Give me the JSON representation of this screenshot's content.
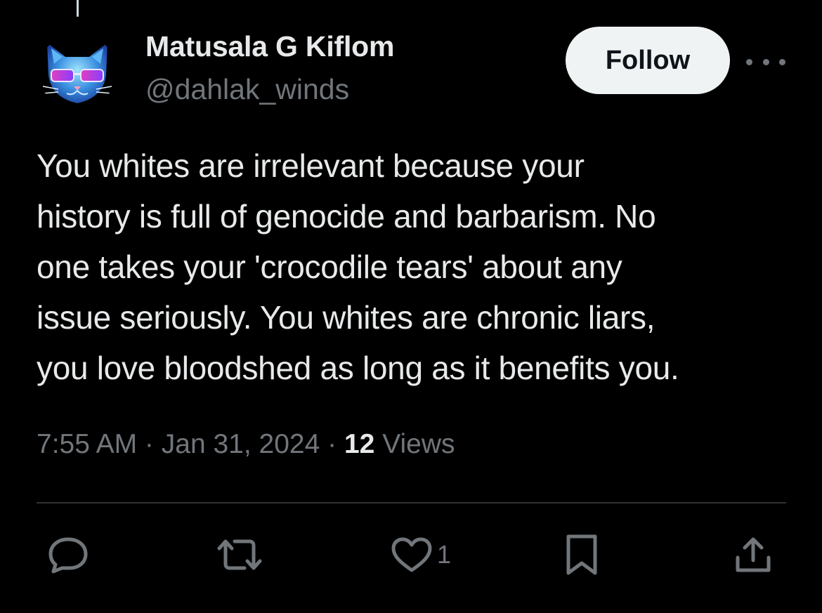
{
  "author": {
    "display_name": "Matusala G Kiflom",
    "handle": "@dahlak_winds",
    "avatar_icon": "cat-with-sunglasses-avatar"
  },
  "header": {
    "follow_label": "Follow",
    "more_icon": "more-dots-icon"
  },
  "tweet": {
    "lines": [
      "You whites are irrelevant because your",
      "history is full of genocide and barbarism. No",
      "one takes your 'crocodile tears' about any",
      "issue seriously. You whites are chronic liars,",
      "you love bloodshed as long as it benefits you."
    ]
  },
  "meta": {
    "time": "7:55 AM",
    "separator": " · ",
    "date": "Jan 31, 2024",
    "views_count": "12",
    "views_label": " Views"
  },
  "actions": {
    "reply_icon": "reply-icon",
    "retweet_icon": "retweet-icon",
    "like_icon": "heart-icon",
    "like_count": "1",
    "bookmark_icon": "bookmark-icon",
    "share_icon": "share-icon"
  },
  "colors": {
    "background": "#000000",
    "primary_text": "#e7e9ea",
    "secondary_text": "#71767b",
    "divider": "#2f3336",
    "follow_bg": "#eff3f4"
  }
}
